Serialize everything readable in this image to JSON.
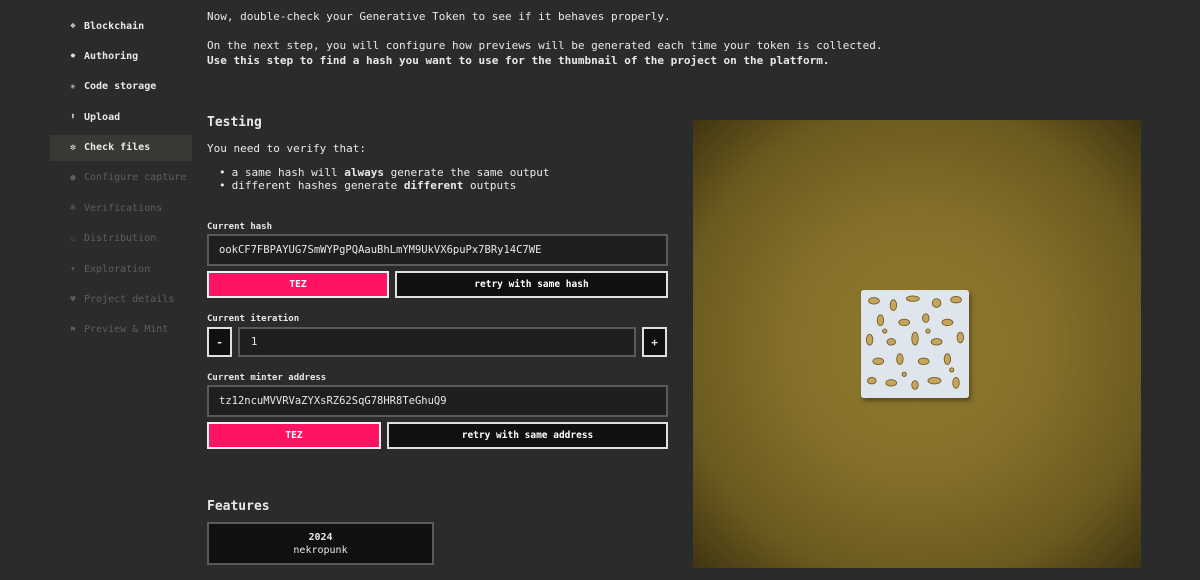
{
  "sidebar": {
    "items": [
      {
        "label": "Blockchain",
        "icon": "diamond-icon",
        "glyph": "❖",
        "state": "done"
      },
      {
        "label": "Authoring",
        "icon": "asterisk-icon",
        "glyph": "✸",
        "state": "done"
      },
      {
        "label": "Code storage",
        "icon": "snowflake-icon",
        "glyph": "✳",
        "state": "done"
      },
      {
        "label": "Upload",
        "icon": "upload-icon",
        "glyph": "⬆",
        "state": "done"
      },
      {
        "label": "Check files",
        "icon": "flower-icon",
        "glyph": "✼",
        "state": "active"
      },
      {
        "label": "Configure capture",
        "icon": "circle-icon",
        "glyph": "●",
        "state": "disabled"
      },
      {
        "label": "Verifications",
        "icon": "sparkle-icon",
        "glyph": "✻",
        "state": "disabled"
      },
      {
        "label": "Distribution",
        "icon": "star-icon",
        "glyph": "✩",
        "state": "disabled"
      },
      {
        "label": "Exploration",
        "icon": "compass-icon",
        "glyph": "✦",
        "state": "disabled"
      },
      {
        "label": "Project details",
        "icon": "heart-icon",
        "glyph": "♥",
        "state": "disabled"
      },
      {
        "label": "Preview & Mint",
        "icon": "flag-icon",
        "glyph": "⚑",
        "state": "disabled"
      }
    ]
  },
  "intro": {
    "line1": "Now, double-check your Generative Token to see if it behaves properly.",
    "line2": "On the next step, you will configure how previews will be generated each time your token is collected.",
    "line3": "Use this step to find a hash you want to use for the thumbnail of the project on the platform."
  },
  "testing": {
    "title": "Testing",
    "verify_text": "You need to verify that:",
    "bullet1_pre": "a same hash will ",
    "bullet1_bold": "always",
    "bullet1_post": " generate the same output",
    "bullet2_pre": "different hashes generate ",
    "bullet2_bold": "different",
    "bullet2_post": " outputs"
  },
  "hash": {
    "label": "Current hash",
    "value": "ookCF7FBPAYUG7SmWYPgPQAauBhLmYM9UkVX6puPx7BRy14C7WE",
    "new_button": "TEZ",
    "retry_button": "retry with same hash"
  },
  "iteration": {
    "label": "Current iteration",
    "value": "1",
    "minus": "-",
    "plus": "+"
  },
  "minter": {
    "label": "Current minter address",
    "value": "tz12ncuMVVRVaZYXsRZ62SqG78HR8TeGhuQ9",
    "new_button": "TEZ",
    "retry_button": "retry with same address"
  },
  "features": {
    "title": "Features",
    "items": [
      {
        "name": "2024",
        "value": "nekropunk"
      }
    ]
  },
  "colors": {
    "accent": "#ff1464",
    "background": "#2b2b2b",
    "preview_bg": "#85702a"
  }
}
